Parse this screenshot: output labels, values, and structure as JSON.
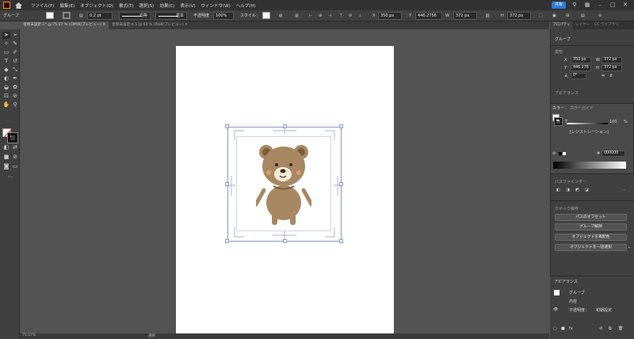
{
  "menubar": {
    "menus": [
      "ファイル(F)",
      "編集(E)",
      "オブジェクト(O)",
      "書式(T)",
      "選択(S)",
      "効果(C)",
      "表示(V)",
      "ウィンドウ(W)",
      "ヘルプ(H)"
    ],
    "share_label": "共有"
  },
  "controlbar": {
    "selection_label": "グループ",
    "stroke_weight": "0.2 pt",
    "stroke_profile": "均等",
    "brush": "基本",
    "opacity_label": "不透明度",
    "opacity_value": "100%",
    "style_label": "スタイル：",
    "x_label": "X",
    "x_value": "350 px",
    "y_label": "Y",
    "y_value": "446.2756",
    "w_label": "W",
    "w_value": "372 px",
    "h_label": "H",
    "h_value": "372 px"
  },
  "tabs": [
    {
      "label": "名称未設定-1* @ 75.57 % (CMYK/プレビュー)",
      "active": true
    },
    {
      "label": "名称未設定-4.5 @ 68 % (RGB/プレビュー)",
      "active": false
    }
  ],
  "statusbar": {
    "zoom": "75.57%",
    "mode_label": "選択"
  },
  "panel": {
    "tabs": [
      "プロパティ",
      "レイヤー",
      "CC ライブラリ"
    ],
    "group_title": "グループ",
    "transform_title": "変形",
    "x_label": "X",
    "x_value": "350 px",
    "y_label": "Y",
    "y_value": "446.276",
    "w_label": "W",
    "w_value": "372 px",
    "h_label": "H",
    "h_value": "372 px",
    "angle_value": "0°",
    "appearance_title": "アピアランス",
    "color_tabs": [
      "カラー",
      "カラーガイド"
    ],
    "tint_label": "T",
    "tint_value": "100",
    "registration_label": "[レジストレーション]",
    "hex_value": "000000",
    "pathfinder_title": "パスファインダー",
    "quick_actions_title": "クイック操作",
    "btn_offset": "パスのオフセット",
    "btn_ungroup": "グループ解除",
    "btn_recolor": "オブジェクトを再配色",
    "btn_select_all": "オブジェクトを一括選択",
    "appearance_bottom": {
      "tab": "アピアランス",
      "group": "グループ",
      "contents": "内容",
      "opacity_label": "不透明度：",
      "opacity_value": "初期設定"
    }
  },
  "colors": {
    "bear": "#a88862",
    "bear_dark": "#7a5e3c",
    "cheek": "#e8a070",
    "muzzle": "#f3ead8"
  }
}
